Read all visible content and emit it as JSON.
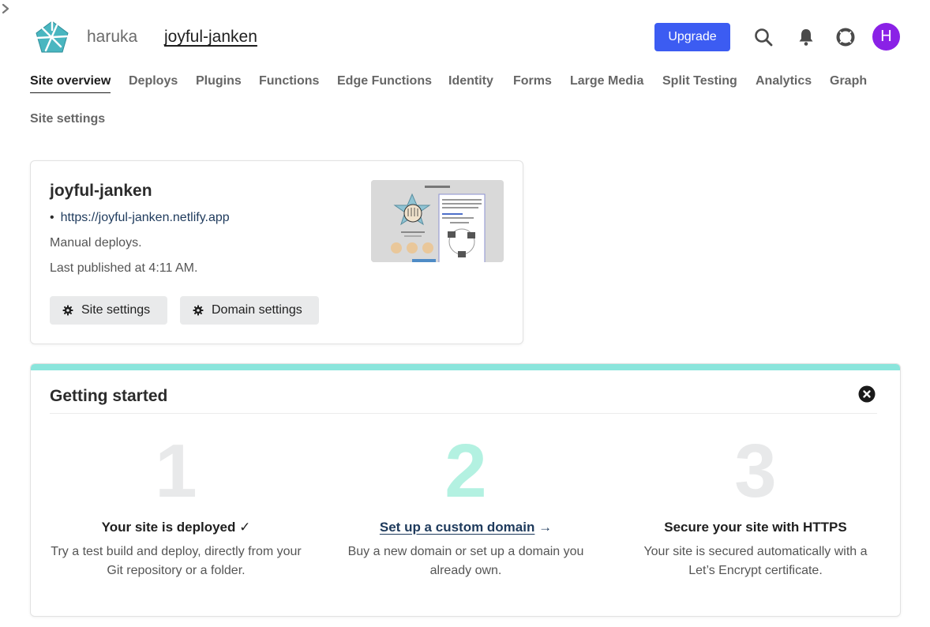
{
  "header": {
    "team": "haruka",
    "site": "joyful-janken",
    "upgrade_label": "Upgrade",
    "avatar_initial": "H",
    "avatar_color": "#8a21e6",
    "accent_color": "#3c5cf2",
    "icons": [
      "netlify-logo",
      "chevron-right-icon",
      "search-icon",
      "bell-icon",
      "help-lifebuoy-icon"
    ]
  },
  "nav": {
    "items": [
      {
        "label": "Site overview",
        "active": true
      },
      {
        "label": "Deploys"
      },
      {
        "label": "Plugins"
      },
      {
        "label": "Functions"
      },
      {
        "label": "Edge Functions"
      },
      {
        "label": "Identity"
      },
      {
        "label": "Forms"
      },
      {
        "label": "Large Media"
      },
      {
        "label": "Split Testing"
      },
      {
        "label": "Analytics"
      },
      {
        "label": "Graph"
      },
      {
        "label": "Site settings"
      }
    ]
  },
  "site_card": {
    "name": "joyful-janken",
    "url": "https://joyful-janken.netlify.app",
    "deploy_mode": "Manual deploys.",
    "last_published": "Last published at 4:11 AM.",
    "site_settings_label": "Site settings",
    "domain_settings_label": "Domain settings"
  },
  "getting_started": {
    "title": "Getting started",
    "bar_color": "#8ae5dc",
    "steps": [
      {
        "number": "1",
        "title": "Your site is deployed ✓",
        "description": "Try a test build and deploy, directly from your Git repository or a folder."
      },
      {
        "number": "2",
        "title": "Set up a custom domain",
        "arrow": "→",
        "description": "Buy a new domain or set up a domain you already own."
      },
      {
        "number": "3",
        "title": "Secure your site with HTTPS",
        "description": "Your site is secured automatically with a Let’s Encrypt certificate."
      }
    ]
  }
}
